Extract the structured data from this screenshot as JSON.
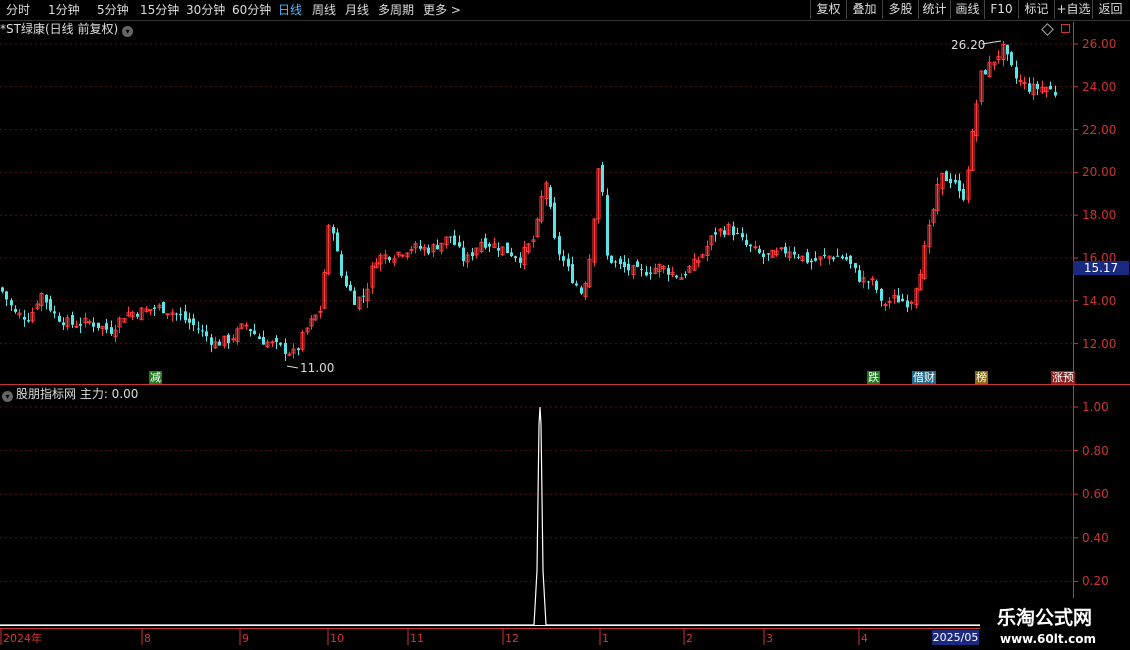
{
  "toolbar": {
    "timeframes": [
      {
        "label": "分时",
        "active": false
      },
      {
        "label": "1分钟",
        "active": false
      },
      {
        "label": "5分钟",
        "active": false
      },
      {
        "label": "15分钟",
        "active": false
      },
      {
        "label": "30分钟",
        "active": false
      },
      {
        "label": "60分钟",
        "active": false
      },
      {
        "label": "日线",
        "active": true
      },
      {
        "label": "周线",
        "active": false
      },
      {
        "label": "月线",
        "active": false
      },
      {
        "label": "多周期",
        "active": false
      },
      {
        "label": "更多 >",
        "active": false
      }
    ],
    "buttons": [
      "复权",
      "叠加",
      "多股",
      "统计",
      "画线",
      "F10",
      "标记",
      "+自选",
      "返回"
    ]
  },
  "stock": {
    "title": "*ST绿康(日线 前复权)"
  },
  "chart_data": [
    {
      "type": "candlestick",
      "yticks": [
        "26.00",
        "24.00",
        "22.00",
        "20.00",
        "18.00",
        "16.00",
        "14.00",
        "12.00"
      ],
      "ylim": [
        10.7,
        27.0
      ],
      "current_price": "15.17",
      "high_label": "26.20",
      "low_label": "11.00",
      "tags": [
        {
          "text": "减",
          "bg": "#1f7a1f"
        },
        {
          "text": "跌",
          "bg": "#1f7a1f"
        },
        {
          "text": "借财",
          "bg": "#1f6a8a"
        },
        {
          "text": "榜",
          "bg": "#8a6a10"
        },
        {
          "text": "涨预",
          "bg": "#8a1f1f"
        }
      ],
      "up_color": "#ff3b3b",
      "down_color": "#5ae6e6",
      "x_labels": [
        "2024年",
        "8",
        "9",
        "10",
        "11",
        "12",
        "1",
        "2",
        "3",
        "4",
        "2025/05"
      ]
    },
    {
      "type": "line",
      "indicator_text": "股朋指标网 主力: 0.00",
      "yticks": [
        "1.00",
        "0.80",
        "0.60",
        "0.40",
        "0.20"
      ],
      "ylim": [
        0.0,
        1.05
      ],
      "values_note_spike": 1.0
    }
  ],
  "watermark": {
    "title": "乐淘公式网",
    "url": "www.60lt.com"
  }
}
